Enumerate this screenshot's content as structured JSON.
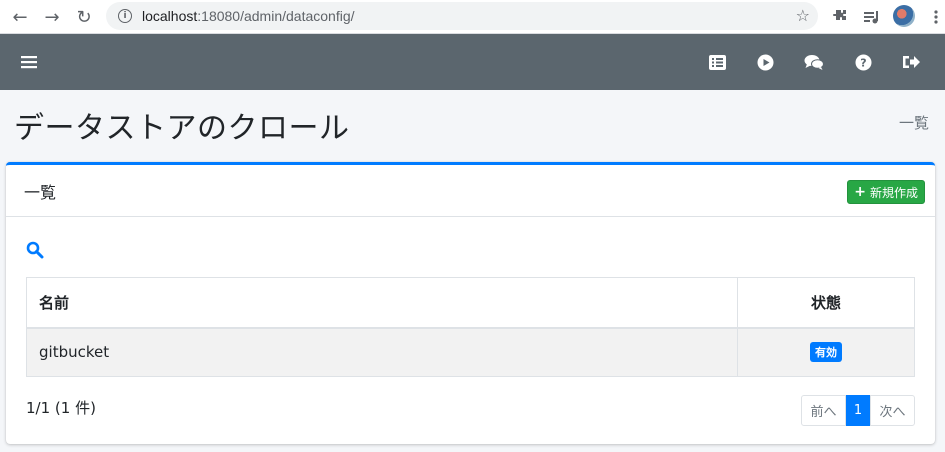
{
  "browser": {
    "url_host": "localhost",
    "url_rest": ":18080/admin/dataconfig/",
    "back": "←",
    "forward": "→",
    "reload": "↻"
  },
  "page": {
    "title": "データストアのクロール",
    "breadcrumb": "一覧"
  },
  "card": {
    "title": "一覧",
    "new_button_label": "新規作成"
  },
  "table": {
    "headers": {
      "name": "名前",
      "status": "状態"
    },
    "rows": [
      {
        "name": "gitbucket",
        "status": "有効"
      }
    ]
  },
  "summary": {
    "count_text": "1/1 (1 件)"
  },
  "pagination": {
    "prev": "前へ",
    "current": "1",
    "next": "次へ"
  },
  "colors": {
    "header_bg": "#5b666e",
    "accent": "#007bff",
    "success": "#28a745"
  }
}
